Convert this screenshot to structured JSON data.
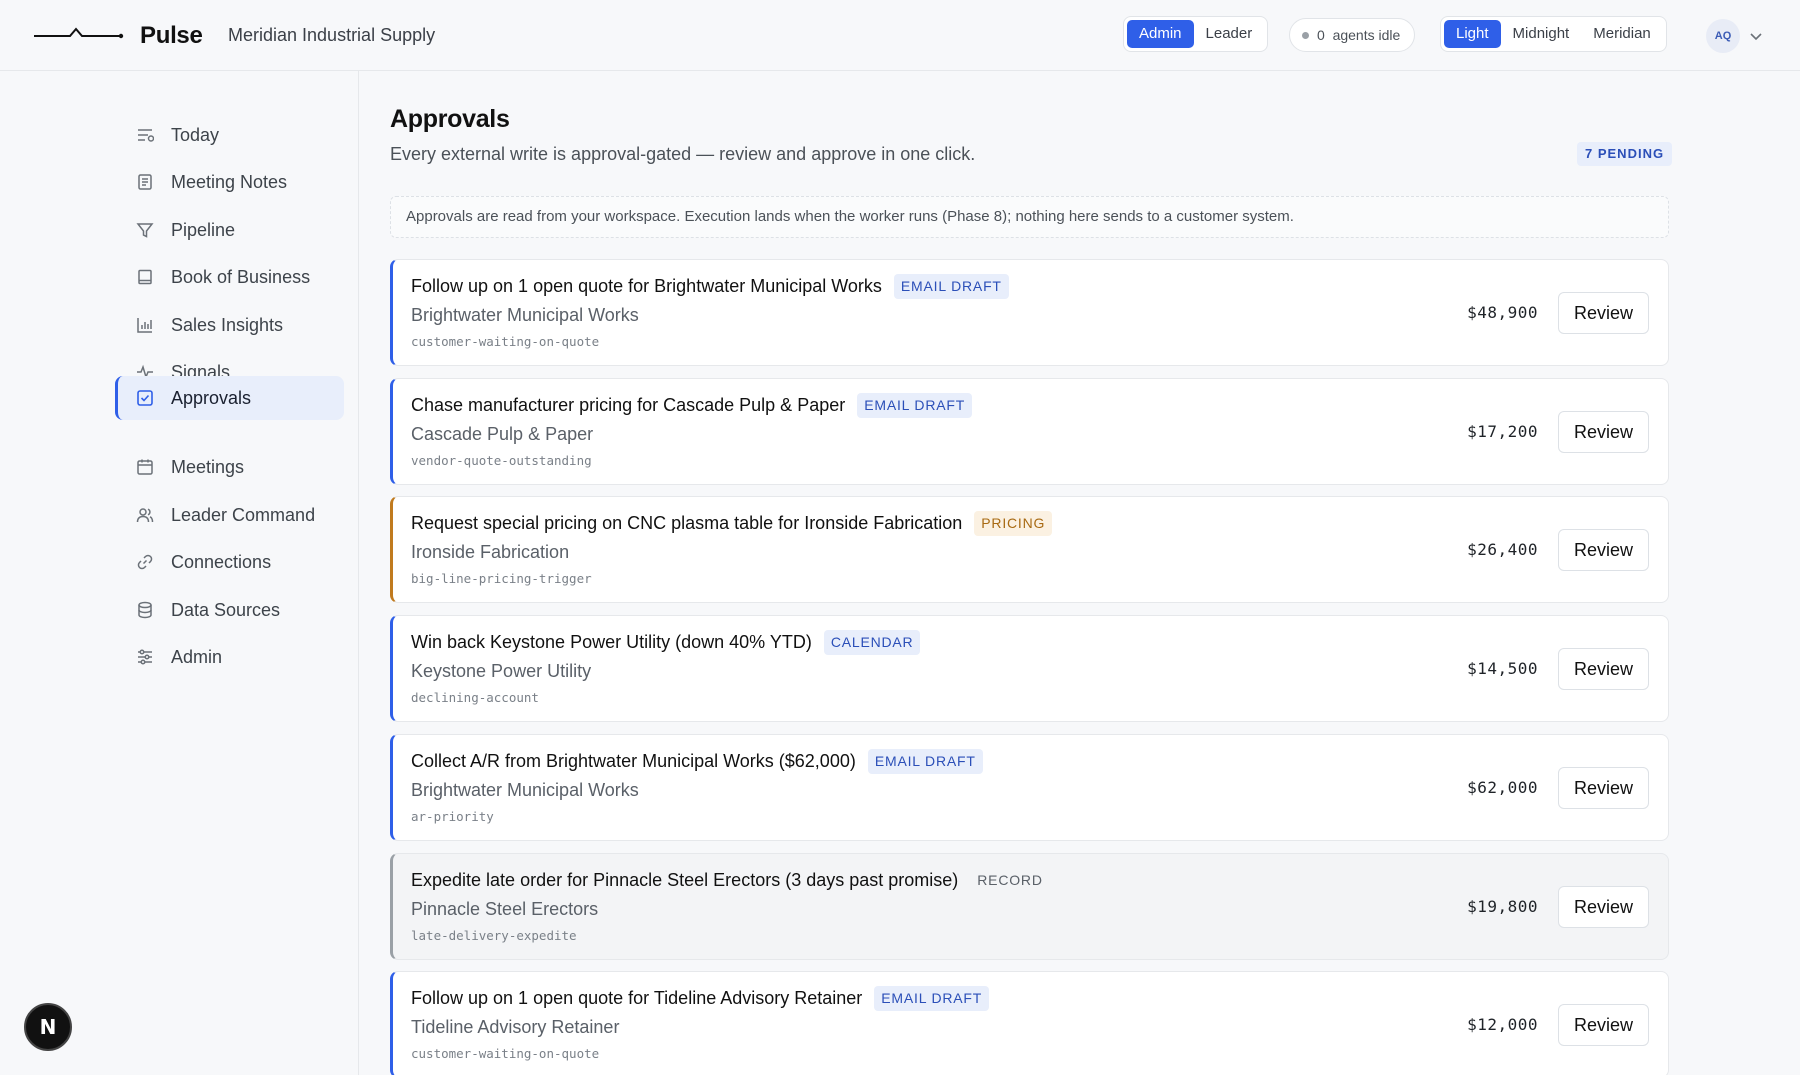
{
  "header": {
    "brand": "Pulse",
    "org": "Meridian Industrial Supply",
    "roles": [
      {
        "label": "Admin",
        "active": true
      },
      {
        "label": "Leader",
        "active": false
      }
    ],
    "agents_status": "0  agents idle",
    "themes": [
      {
        "label": "Light",
        "active": true
      },
      {
        "label": "Midnight",
        "active": false
      },
      {
        "label": "Meridian",
        "active": false
      }
    ],
    "avatar_initials": "AQ",
    "accent_color": "#2f5fe8"
  },
  "sidebar": {
    "items": [
      {
        "label": "Today",
        "icon": "list-icon"
      },
      {
        "label": "Meeting Notes",
        "icon": "notebook-icon"
      },
      {
        "label": "Pipeline",
        "icon": "funnel-icon"
      },
      {
        "label": "Book of Business",
        "icon": "book-icon"
      },
      {
        "label": "Sales Insights",
        "icon": "bar-chart-icon"
      },
      {
        "label": "Signals",
        "icon": "pulse-icon"
      },
      {
        "label": "Approvals",
        "icon": "check-square-icon",
        "active": true
      },
      {
        "label": "Meetings",
        "icon": "calendar-icon"
      },
      {
        "label": "Leader Command",
        "icon": "users-icon"
      },
      {
        "label": "Connections",
        "icon": "link-icon"
      },
      {
        "label": "Data Sources",
        "icon": "database-icon"
      },
      {
        "label": "Admin",
        "icon": "sliders-icon"
      }
    ],
    "badge": "N"
  },
  "main": {
    "title": "Approvals",
    "subtitle": "Every external write is approval-gated — review and approve in one click.",
    "pending_badge": "7 PENDING",
    "notice": "Approvals are read from your workspace. Execution lands when the worker runs (Phase 8); nothing here sends to a customer system.",
    "review_label": "Review",
    "cards": [
      {
        "title": "Follow up on 1 open quote for Brightwater Municipal Works",
        "tag": "EMAIL DRAFT",
        "tag_style": "blue",
        "company": "Brightwater Municipal Works",
        "code": "customer-waiting-on-quote",
        "amount": "$48,900",
        "accent": "blue"
      },
      {
        "title": "Chase manufacturer pricing for Cascade Pulp & Paper",
        "tag": "EMAIL DRAFT",
        "tag_style": "blue",
        "company": "Cascade Pulp & Paper",
        "code": "vendor-quote-outstanding",
        "amount": "$17,200",
        "accent": "blue"
      },
      {
        "title": "Request special pricing on CNC plasma table for Ironside Fabrication",
        "tag": "PRICING",
        "tag_style": "amber",
        "company": "Ironside Fabrication",
        "code": "big-line-pricing-trigger",
        "amount": "$26,400",
        "accent": "amber"
      },
      {
        "title": "Win back Keystone Power Utility (down 40% YTD)",
        "tag": "CALENDAR",
        "tag_style": "blue",
        "company": "Keystone Power Utility",
        "code": "declining-account",
        "amount": "$14,500",
        "accent": "blue"
      },
      {
        "title": "Collect A/R from Brightwater Municipal Works ($62,000)",
        "tag": "EMAIL DRAFT",
        "tag_style": "blue",
        "company": "Brightwater Municipal Works",
        "code": "ar-priority",
        "amount": "$62,000",
        "accent": "blue"
      },
      {
        "title": "Expedite late order for Pinnacle Steel Erectors (3 days past promise)",
        "tag": "RECORD",
        "tag_style": "plain",
        "company": "Pinnacle Steel Erectors",
        "code": "late-delivery-expedite",
        "amount": "$19,800",
        "accent": "grey"
      },
      {
        "title": "Follow up on 1 open quote for Tideline Advisory Retainer",
        "tag": "EMAIL DRAFT",
        "tag_style": "blue",
        "company": "Tideline Advisory Retainer",
        "code": "customer-waiting-on-quote",
        "amount": "$12,000",
        "accent": "blue"
      }
    ]
  }
}
